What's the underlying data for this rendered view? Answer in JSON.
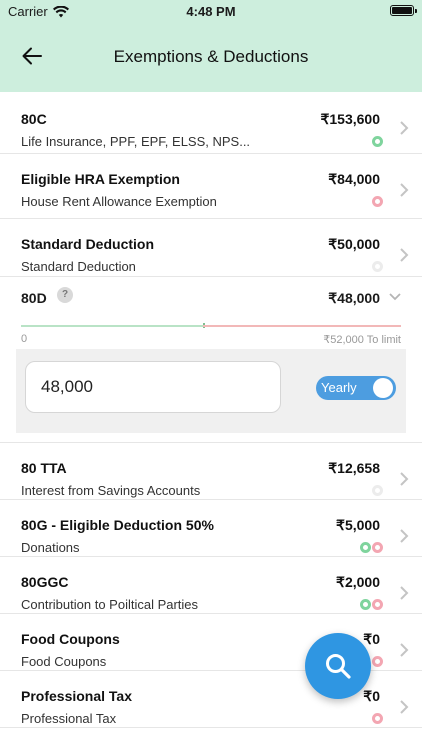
{
  "status_bar": {
    "carrier": "Carrier",
    "time": "4:48 PM"
  },
  "header": {
    "title": "Exemptions & Deductions"
  },
  "rows": [
    {
      "title": "80C",
      "subtitle": "Life Insurance, PPF, EPF, ELSS, NPS...",
      "amount": "₹153,600",
      "dots": [
        "green"
      ]
    },
    {
      "title": "Eligible HRA Exemption",
      "subtitle": "House Rent Allowance Exemption",
      "amount": "₹84,000",
      "dots": [
        "pink"
      ]
    },
    {
      "title": "Standard Deduction",
      "subtitle": "Standard Deduction",
      "amount": "₹50,000",
      "dots": [
        "light"
      ]
    }
  ],
  "expanded": {
    "title": "80D",
    "help": "?",
    "amount": "₹48,000",
    "progress_min": "0",
    "progress_max": "₹52,000 To limit",
    "progress_fraction": 0.48,
    "input_value": "48,000",
    "toggle_label": "Yearly",
    "toggle_on": true
  },
  "rows2": [
    {
      "title": "80 TTA",
      "subtitle": "Interest from Savings Accounts",
      "amount": "₹12,658",
      "dots": [
        "light"
      ]
    },
    {
      "title": "80G - Eligible Deduction 50%",
      "subtitle": "Donations",
      "amount": "₹5,000",
      "dots": [
        "green",
        "pink"
      ]
    },
    {
      "title": "80GGC",
      "subtitle": "Contribution to Poiltical Parties",
      "amount": "₹2,000",
      "dots": [
        "green",
        "pink"
      ]
    },
    {
      "title": "Food Coupons",
      "subtitle": "Food Coupons",
      "amount": "₹0",
      "dots": [
        "pink"
      ]
    },
    {
      "title": "Professional Tax",
      "subtitle": "Professional Tax",
      "amount": "₹0",
      "dots": [
        "pink"
      ]
    }
  ],
  "icons": {
    "back": "arrow-left-icon",
    "fab": "search-icon",
    "chevron": "chevron-right-icon"
  },
  "colors": {
    "header_bg": "#cdeedd",
    "accent": "#2f96e2",
    "toggle": "#4d9de0"
  }
}
